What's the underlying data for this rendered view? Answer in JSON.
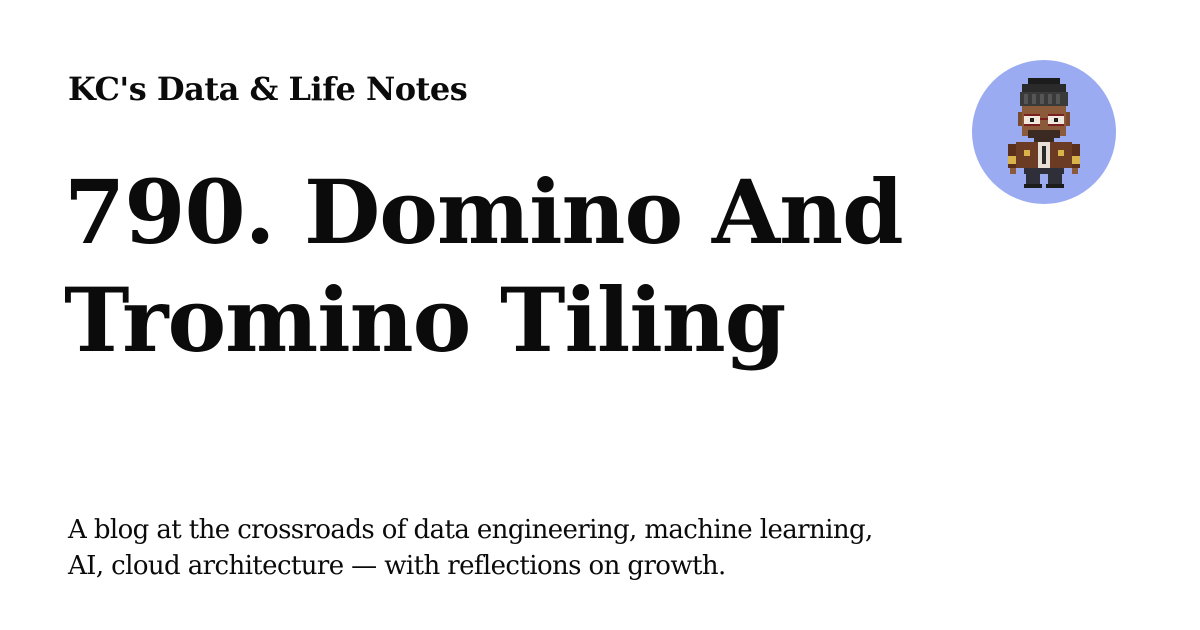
{
  "site": {
    "name": "KC's Data & Life Notes"
  },
  "post": {
    "title": "790. Domino And Tromino Tiling"
  },
  "site_description": "A blog at the crossroads of data engineering, machine learning, AI, cloud architecture — with reflections on growth.",
  "avatar": {
    "icon": "pixel-art-character-icon",
    "background_color": "#9aabf2"
  },
  "colors": {
    "background": "#ffffff",
    "text": "#0b0b0b"
  }
}
